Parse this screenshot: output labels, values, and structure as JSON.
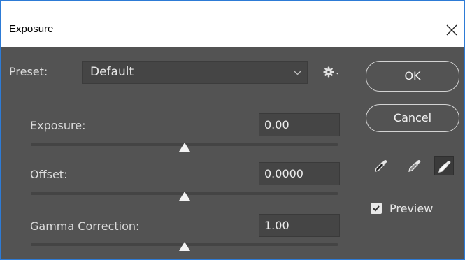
{
  "window": {
    "title": "Exposure",
    "close_label": "×"
  },
  "preset": {
    "label": "Preset:",
    "value": "Default"
  },
  "controls": [
    {
      "label": "Exposure:",
      "value": "0.00",
      "slider_level": 0.5
    },
    {
      "label": "Offset:",
      "value": "0.0000",
      "slider_level": 0.5
    },
    {
      "label": "Gamma Correction:",
      "value": "1.00",
      "slider_level": 0.5
    }
  ],
  "buttons": {
    "ok": "OK",
    "cancel": "Cancel"
  },
  "eyedroppers": [
    {
      "icon": "black-point-eyedropper-icon"
    },
    {
      "icon": "gray-point-eyedropper-icon"
    },
    {
      "icon": "white-point-eyedropper-icon",
      "selected": true
    }
  ],
  "preview": {
    "label": "Preview",
    "checked": true
  },
  "colors": {
    "panel": "#535353",
    "field": "#454545",
    "window_border": "#2d7bd6"
  }
}
